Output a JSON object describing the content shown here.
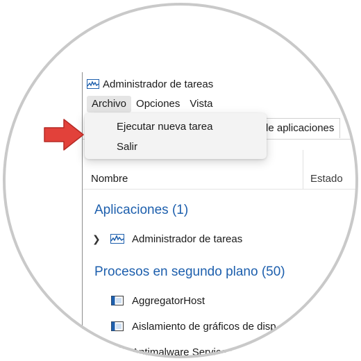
{
  "window": {
    "title": "Administrador de tareas"
  },
  "menubar": {
    "items": [
      "Archivo",
      "Opciones",
      "Vista"
    ]
  },
  "file_menu": {
    "items": [
      "Ejecutar nueva tarea",
      "Salir"
    ]
  },
  "tabs": {
    "visible_label": "de aplicaciones"
  },
  "columns": {
    "name": "Nombre",
    "status": "Estado"
  },
  "sections": {
    "apps": {
      "title": "Aplicaciones (1)",
      "rows": [
        "Administrador de tareas"
      ]
    },
    "background": {
      "title": "Procesos en segundo plano (50)",
      "rows": [
        "AggregatorHost",
        "Aislamiento de gráficos de disp",
        "Antimalware Service E"
      ]
    }
  },
  "colors": {
    "accent": "#1d5fad",
    "arrow": "#e2413a",
    "dropdown_bg": "#f3f3f3"
  },
  "icons": {
    "window": "task-manager-icon",
    "process": "process-icon",
    "expand": "chevron-right-icon",
    "pointer": "red-arrow-icon"
  }
}
